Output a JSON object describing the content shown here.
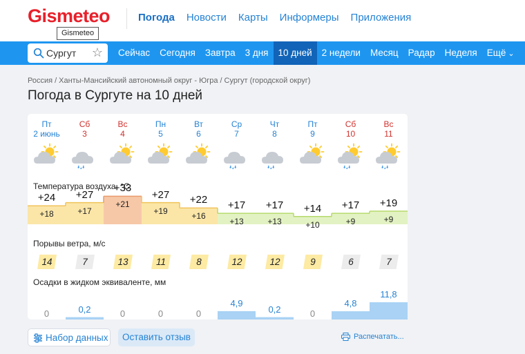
{
  "header": {
    "logo": "Gismeteo",
    "logo_tooltip": "Gismeteo",
    "nav": [
      "Погода",
      "Новости",
      "Карты",
      "Информеры",
      "Приложения"
    ]
  },
  "search": {
    "value": "Сургут"
  },
  "tabs": [
    "Сейчас",
    "Сегодня",
    "Завтра",
    "3 дня",
    "10 дней",
    "2 недели",
    "Месяц",
    "Радар",
    "Неделя",
    "Ещё"
  ],
  "selected_tab": "10 дней",
  "breadcrumbs": [
    "Россия",
    "Ханты-Мансийский автономный округ - Югра",
    "Сургут (городской округ)"
  ],
  "title": "Погода в Сургуте на 10 дней",
  "days": [
    {
      "name": "Пт",
      "date": "2 июнь",
      "weekend": false,
      "icon": "sun-cloud-icon",
      "tmax": "+24",
      "tmin": "+18",
      "gust": "14",
      "precip": "0"
    },
    {
      "name": "Сб",
      "date": "3",
      "weekend": true,
      "icon": "cloud-rain-icon",
      "tmax": "+27",
      "tmin": "+17",
      "gust": "7",
      "precip": "0,2"
    },
    {
      "name": "Вс",
      "date": "4",
      "weekend": true,
      "icon": "sun-cloud-icon",
      "tmax": "+33",
      "tmin": "+21",
      "gust": "13",
      "precip": "0"
    },
    {
      "name": "Пн",
      "date": "5",
      "weekend": false,
      "icon": "sun-cloud-icon",
      "tmax": "+27",
      "tmin": "+19",
      "gust": "11",
      "precip": "0"
    },
    {
      "name": "Вт",
      "date": "6",
      "weekend": false,
      "icon": "sun-cloud-icon",
      "tmax": "+22",
      "tmin": "+16",
      "gust": "8",
      "precip": "0"
    },
    {
      "name": "Ср",
      "date": "7",
      "weekend": false,
      "icon": "cloud-rain-icon",
      "tmax": "+17",
      "tmin": "+13",
      "gust": "12",
      "precip": "4,9"
    },
    {
      "name": "Чт",
      "date": "8",
      "weekend": false,
      "icon": "cloud-rain-icon",
      "tmax": "+17",
      "tmin": "+13",
      "gust": "12",
      "precip": "0,2"
    },
    {
      "name": "Пт",
      "date": "9",
      "weekend": false,
      "icon": "sun-cloud-icon",
      "tmax": "+14",
      "tmin": "+10",
      "gust": "9",
      "precip": "0"
    },
    {
      "name": "Сб",
      "date": "10",
      "weekend": true,
      "icon": "sun-cloud-rain-icon",
      "tmax": "+17",
      "tmin": "+9",
      "gust": "6",
      "precip": "4,8"
    },
    {
      "name": "Вс",
      "date": "11",
      "weekend": true,
      "icon": "sun-cloud-rain-icon",
      "tmax": "+19",
      "tmin": "+9",
      "gust": "7",
      "precip": "11,8"
    }
  ],
  "sections": {
    "temp": "Температура воздуха, °C",
    "gust": "Порывы ветра, м/с",
    "precip": "Осадки в жидком эквиваленте, мм"
  },
  "buttons": {
    "data_set": "Набор данных",
    "feedback": "Оставить отзыв",
    "print": "Распечатать..."
  },
  "colors": {
    "brand_red": "#e8202a",
    "nav_blue": "#1e96f0",
    "selected_tab": "#1164b8",
    "link": "#2583d4",
    "precip_bar": "#a9d2f4",
    "gust_yellow": "#fdeaa3",
    "gust_gray": "#ececec"
  }
}
